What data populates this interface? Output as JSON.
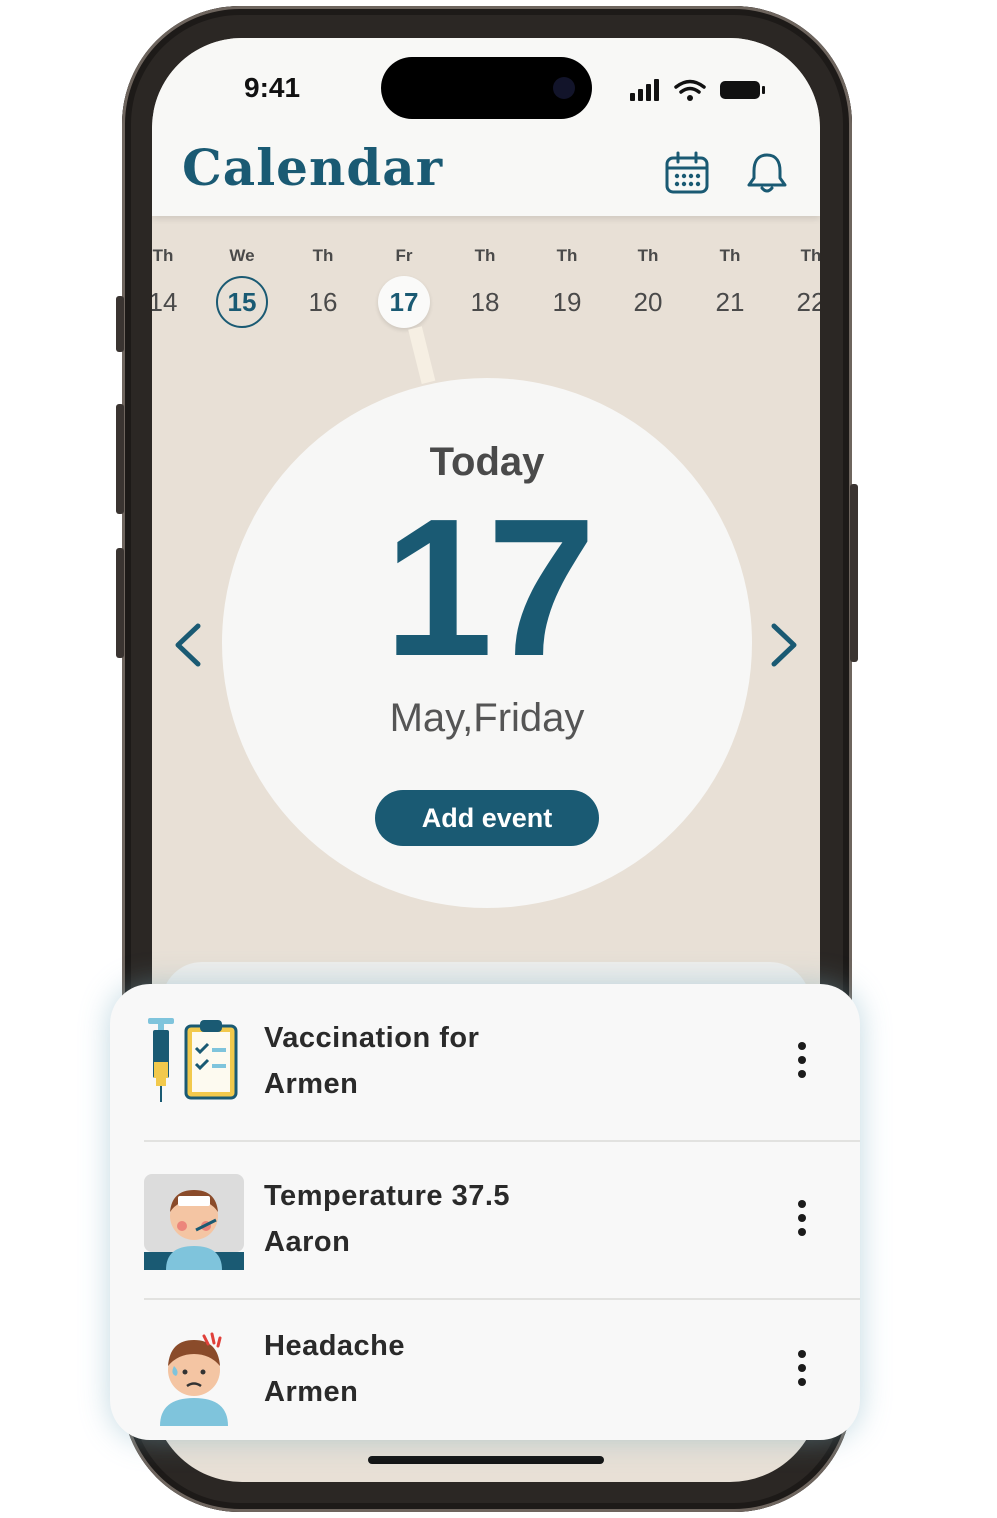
{
  "status_bar": {
    "time": "9:41"
  },
  "header": {
    "title": "Calendar"
  },
  "week_strip": [
    {
      "name": "Th",
      "num": "14"
    },
    {
      "name": "We",
      "num": "15"
    },
    {
      "name": "Th",
      "num": "16"
    },
    {
      "name": "Fr",
      "num": "17"
    },
    {
      "name": "Th",
      "num": "18"
    },
    {
      "name": "Th",
      "num": "19"
    },
    {
      "name": "Th",
      "num": "20"
    },
    {
      "name": "Th",
      "num": "21"
    },
    {
      "name": "Th",
      "num": "22"
    }
  ],
  "today": {
    "label": "Today",
    "day": "17",
    "subtitle": "May,Friday",
    "add_button": "Add event"
  },
  "events": [
    {
      "title": "Vaccination for",
      "person": "Armen",
      "icon": "vaccination-checklist-icon"
    },
    {
      "title": "Temperature 37.5",
      "person": "Aaron",
      "icon": "sick-child-thermometer-icon"
    },
    {
      "title": "Headache",
      "person": "Armen",
      "icon": "child-headache-icon"
    }
  ],
  "colors": {
    "accent": "#1a5a73",
    "background": "#e8e0d6",
    "card": "#f8f8f8"
  }
}
